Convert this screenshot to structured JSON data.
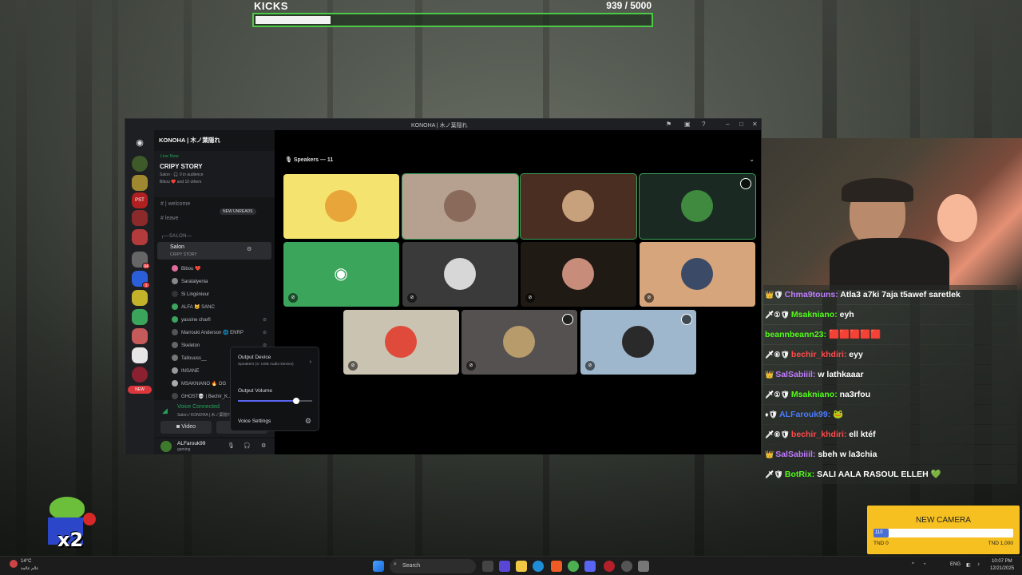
{
  "kicks": {
    "title": "KICKS",
    "count": "939  / 5000",
    "progress": 0.188
  },
  "discord": {
    "window_title": "KONOHA | 木ノ葉隠れ",
    "server_name": "KONOHA | 木ノ葉隠れ",
    "live": {
      "label": "Live Now",
      "stage": "CRIPY STORY",
      "sub": "Salon · 🎧 0 in audience",
      "who": "Bibou ❤️ and 10 others"
    },
    "channels": {
      "welcome": "| welcome",
      "new_unreads": "NEW UNREADS",
      "leave": "leave",
      "category": "SALON",
      "salon": "Salon",
      "salon_sub": "CRIPY STORY"
    },
    "members": [
      "Bibou ❤️",
      "Saratalyenia",
      "Si Lingénieur",
      "ALFA 🐱 SANC",
      "yassine charfi",
      "Marrouki Anderson 🌐 ENRP",
      "Skeleton",
      "Tallouuss__",
      "INSANE",
      "MSAKNIANO 🔥 OG",
      "GHOST💀 | Bechir_K..."
    ],
    "guild_badges": [
      "PST",
      "94",
      "1",
      "NEW"
    ],
    "voice": {
      "status": "Voice Connected",
      "location": "Salon / KONOHA | 木ノ葉隠れ",
      "video_label": "Video",
      "share_label": "S"
    },
    "user": {
      "name": "ALFarouk99",
      "status": "gaming"
    },
    "speakers_label": "Speakers — 11",
    "popup": {
      "output_device_label": "Output Device",
      "output_device_value": "Speakers (4- USB Audio Device)",
      "output_volume_label": "Output Volume",
      "output_volume": 0.78,
      "voice_settings_label": "Voice Settings"
    },
    "tiles": [
      {
        "bg": "#f4e46f",
        "avatar": "#e8a53a",
        "speaking": false,
        "muted": false,
        "shield": false
      },
      {
        "bg": "#b6a191",
        "avatar": "#8a6b5b",
        "speaking": true,
        "muted": false,
        "shield": false
      },
      {
        "bg": "#4a2e22",
        "avatar": "#c7a07c",
        "speaking": true,
        "muted": false,
        "shield": false
      },
      {
        "bg": "#1a2a22",
        "avatar": "#3f8a3f",
        "speaking": true,
        "muted": false,
        "shield": true
      },
      {
        "bg": "#3ba55c",
        "avatar": "#3ba55c",
        "speaking": false,
        "muted": true,
        "shield": false
      },
      {
        "bg": "#3a3a3a",
        "avatar": "#d7d7d7",
        "speaking": false,
        "muted": true,
        "shield": false
      },
      {
        "bg": "#1f1a14",
        "avatar": "#c78c7a",
        "speaking": false,
        "muted": true,
        "shield": false
      },
      {
        "bg": "#d6a57c",
        "avatar": "#3b4a66",
        "speaking": false,
        "muted": true,
        "shield": false
      },
      {
        "bg": "#cbc3b1",
        "avatar": "#e04a3a",
        "speaking": false,
        "muted": true,
        "shield": false
      },
      {
        "bg": "#545150",
        "avatar": "#b89b6b",
        "speaking": false,
        "muted": true,
        "shield": true
      },
      {
        "bg": "#9fb7cc",
        "avatar": "#2a2a2a",
        "speaking": false,
        "muted": true,
        "shield": true
      }
    ]
  },
  "chat": [
    {
      "badges": "👑🛡",
      "user": "Chma9touns",
      "color": "#c07cff",
      "text": "Atla3 a7ki 7aja t5awef saretlek"
    },
    {
      "badges": "🗡①🛡",
      "user": "Msakniano",
      "color": "#53fc18",
      "text": "eyh"
    },
    {
      "badges": "",
      "user": "beannbeann23",
      "color": "#53fc18",
      "text": "🟥🟥🟥🟥🟥"
    },
    {
      "badges": "🗡⑥🛡",
      "user": "bechir_khdiri",
      "color": "#ff4b4b",
      "text": "eyy"
    },
    {
      "badges": "👑",
      "user": "SalSabiiil",
      "color": "#c07cff",
      "text": "w lathkaaar"
    },
    {
      "badges": "🗡①🛡",
      "user": "Msakniano",
      "color": "#53fc18",
      "text": "na3rfou"
    },
    {
      "badges": "♦🛡",
      "user": "ALFarouk99",
      "color": "#4a7bff",
      "text": "🐸"
    },
    {
      "badges": "🗡⑥🛡",
      "user": "bechir_khdiri",
      "color": "#ff4b4b",
      "text": "ell ktéf"
    },
    {
      "badges": "👑",
      "user": "SalSabiiil",
      "color": "#c07cff",
      "text": "sbeh w la3chia"
    },
    {
      "badges": "🗡🛡",
      "user": "BotRix",
      "color": "#53fc18",
      "text": "SALI AALA RASOUL ELLEH 💚"
    }
  ],
  "goal": {
    "title": "NEW CAMERA",
    "fill_label": "110",
    "progress": 0.11,
    "min": "TND 0",
    "max": "TND 1,000"
  },
  "overlay": {
    "multiplier": "x2"
  },
  "taskbar": {
    "weather_temp": "14°C",
    "weather_text": "عالم عالمة",
    "search_placeholder": "Search",
    "lang": "ENG",
    "time": "10:07 PM",
    "date": "12/21/2025"
  }
}
